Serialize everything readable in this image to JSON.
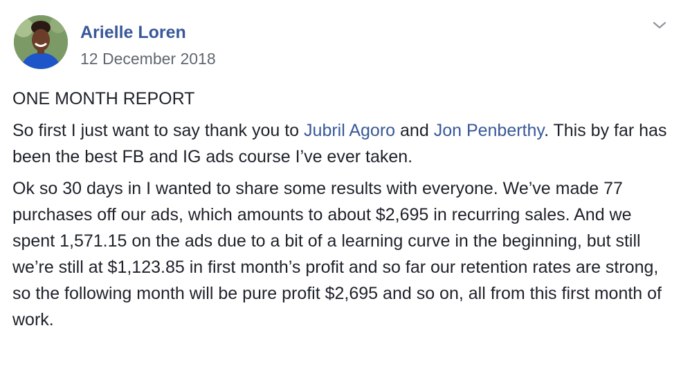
{
  "post": {
    "author": "Arielle Loren",
    "date": "12 December 2018",
    "options_icon": "chevron-down-icon",
    "title": "ONE MONTH REPORT",
    "paragraph1": {
      "intro": "So first I just want to say thank you to ",
      "mention1": "Jubril Agoro",
      "and": " and ",
      "mention2": "Jon Penberthy",
      "rest": ". This by far has been the best FB and IG ads course I’ve ever taken."
    },
    "paragraph2": "Ok so 30 days in I wanted to share some results with everyone. We’ve made 77 purchases off our ads, which amounts to about $2,695 in recurring sales. And we spent 1,571.15 on the ads due to a bit of a learning curve in the beginning, but still we’re still at $1,123.85 in first month’s profit and so far our retention rates are strong, so the following month will be pure profit $2,695 and so on, all from this first month of work.",
    "colors": {
      "link": "#385898",
      "meta": "#616770",
      "text": "#1d2129"
    }
  }
}
